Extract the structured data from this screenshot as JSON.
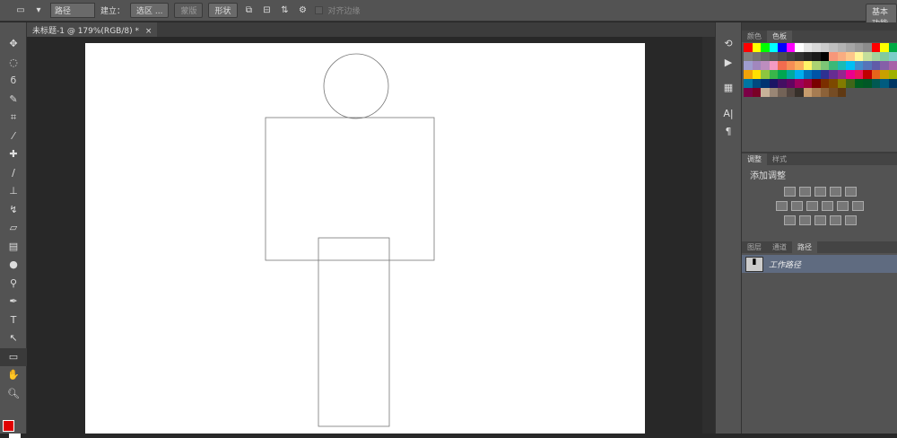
{
  "options_bar": {
    "mode": "路径",
    "make_label": "建立：",
    "selection_btn": "选区 ...",
    "mask_btn": "蒙版",
    "shape_btn": "形状",
    "align_edges": "对齐边缘",
    "workspace": "基本功能"
  },
  "document_tab": {
    "title": "未标题-1 @ 179%(RGB/8) *",
    "close": "×"
  },
  "panels": {
    "color_tabs": [
      "颜色",
      "色板"
    ],
    "adjust_tabs": [
      "调整",
      "样式"
    ],
    "add_adjustment": "添加调整",
    "layer_tabs": [
      "图层",
      "通道",
      "路径"
    ],
    "work_path": "工作路径"
  },
  "foreground_color": "#e00000",
  "swatches": [
    [
      "#ff0000",
      "#ffff00",
      "#00ff00",
      "#00ffff",
      "#0000ff",
      "#ff00ff",
      "#ffffff",
      "#e6e6e6",
      "#d9d9d9",
      "#cccccc",
      "#bfbfbf",
      "#b3b3b3",
      "#a6a6a6",
      "#999999",
      "#8c8c8c",
      "#ff0000",
      "#ffff00",
      "#00aa44"
    ],
    [
      "#808080",
      "#737373",
      "#666666",
      "#595959",
      "#4d4d4d",
      "#404040",
      "#333333",
      "#262626",
      "#1a1a1a",
      "#000000",
      "#f7977a",
      "#f9ad81",
      "#fdc68a",
      "#fff79a",
      "#c4df9b",
      "#a2d39c",
      "#82ca9d",
      "#7bcdc8"
    ],
    [
      "#9e9dcf",
      "#a187be",
      "#bc8dbf",
      "#f49ac2",
      "#f26c4f",
      "#f68e55",
      "#fbaf5c",
      "#fff467",
      "#acd372",
      "#7cc576",
      "#3bb878",
      "#1abbb4",
      "#00bff3",
      "#438ccb",
      "#5574b9",
      "#605ca8",
      "#855fa8",
      "#a763a8"
    ],
    [
      "#f0a30a",
      "#ffe000",
      "#8dc63f",
      "#39b54a",
      "#00a651",
      "#00a99d",
      "#00aeef",
      "#0072bc",
      "#0054a6",
      "#2e3192",
      "#662d91",
      "#92278f",
      "#ec008c",
      "#ed145b",
      "#c00000",
      "#e8641b",
      "#c8a000",
      "#a0b000"
    ],
    [
      "#0076a3",
      "#004a80",
      "#003471",
      "#1b1464",
      "#440e62",
      "#630460",
      "#9e005d",
      "#9e0039",
      "#790000",
      "#7b2e00",
      "#7d4900",
      "#827b00",
      "#406618",
      "#005e20",
      "#005826",
      "#005952",
      "#005b7f",
      "#003663"
    ],
    [
      "#7b0046",
      "#7a0026",
      "#c7b299",
      "#998675",
      "#736357",
      "#534741",
      "#37302a",
      "#c69c6d",
      "#a67c52",
      "#8c6239",
      "#754c24",
      "#603913"
    ]
  ],
  "shapes": {
    "circle": "ellipse",
    "body": "rectangle",
    "leg": "rectangle"
  }
}
